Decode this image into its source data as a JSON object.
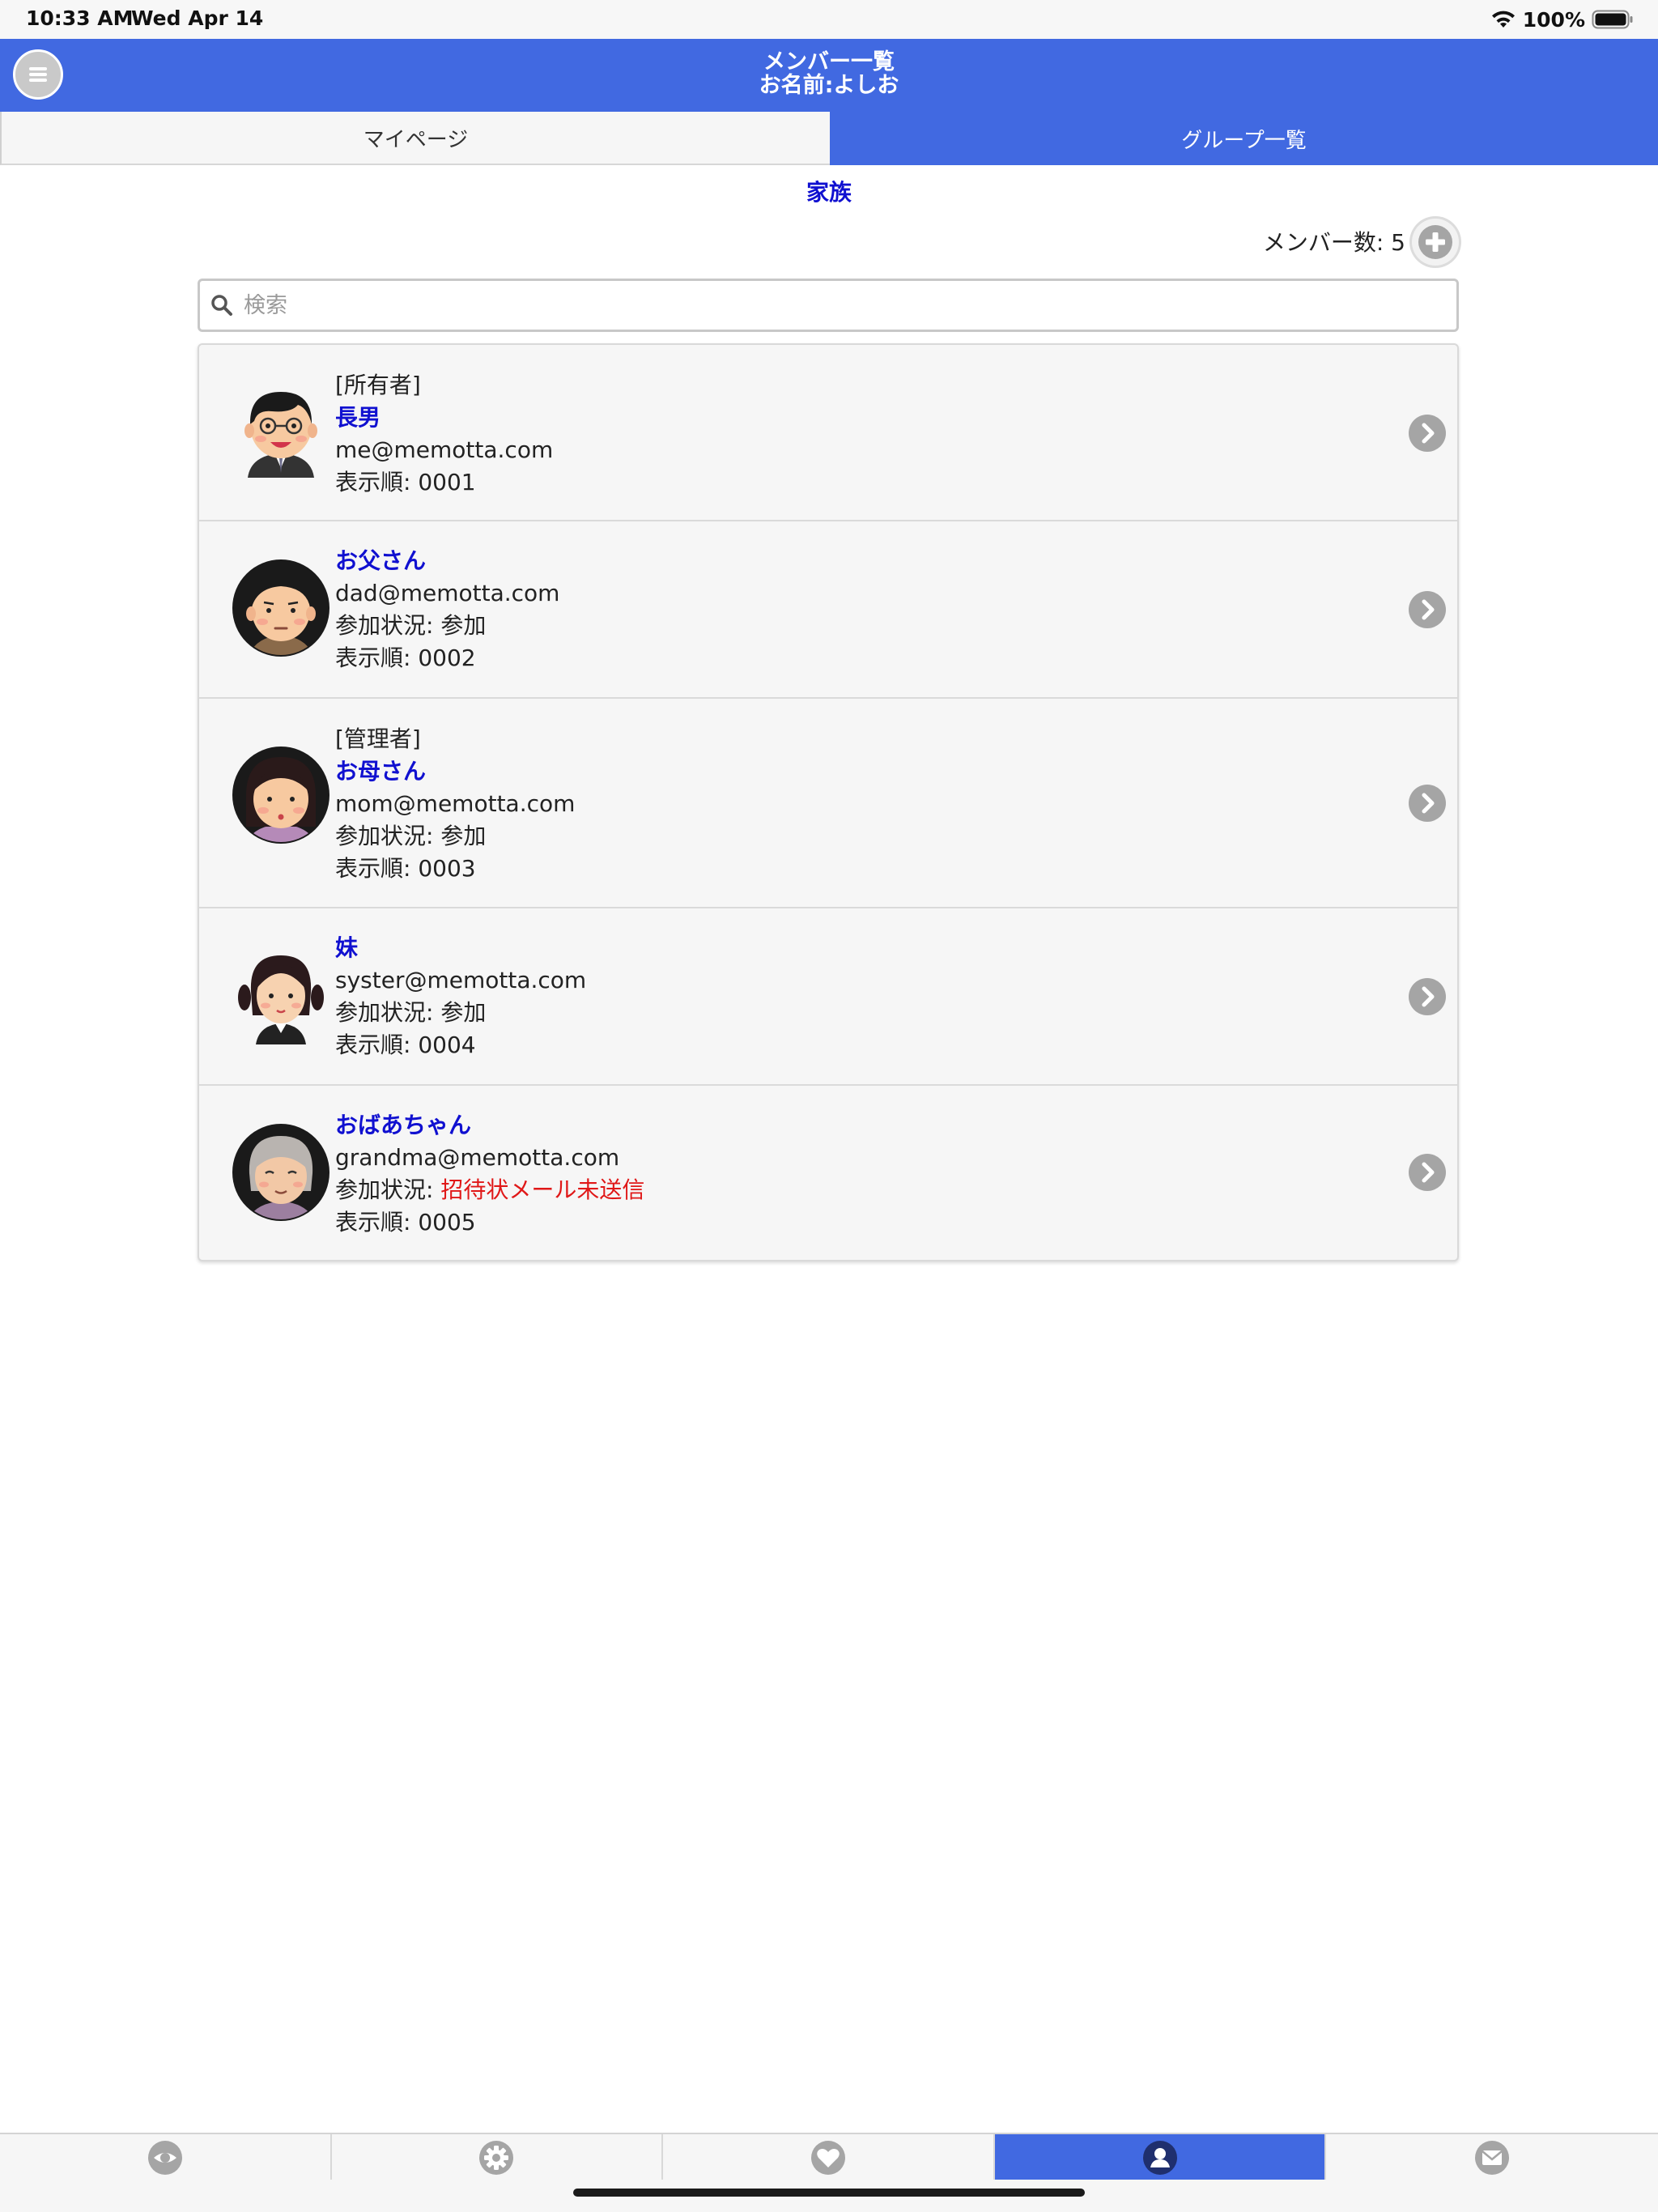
{
  "status_bar": {
    "time": "10:33 AM",
    "date": "Wed Apr 14",
    "battery": "100%"
  },
  "header": {
    "title": "メンバー一覧",
    "subtitle": "お名前:よしお"
  },
  "tabs": [
    {
      "label": "マイページ"
    },
    {
      "label": "グループ一覧"
    }
  ],
  "group": {
    "name": "家族"
  },
  "member_count": {
    "label": "メンバー数: 5"
  },
  "search": {
    "placeholder": "検索"
  },
  "members": [
    {
      "role": "[所有者]",
      "name": "長男",
      "email": "me@memotta.com",
      "order": "表示順: 0001"
    },
    {
      "name": "お父さん",
      "email": "dad@memotta.com",
      "status_label": "参加状況: ",
      "status": "参加",
      "order": "表示順: 0002"
    },
    {
      "role": "[管理者]",
      "name": "お母さん",
      "email": "mom@memotta.com",
      "status_label": "参加状況: ",
      "status": "参加",
      "order": "表示順: 0003"
    },
    {
      "name": "妹",
      "email": "syster@memotta.com",
      "status_label": "参加状況: ",
      "status": "参加",
      "order": "表示順: 0004"
    },
    {
      "name": "おばあちゃん",
      "email": "grandma@memotta.com",
      "status_label": "参加状況: ",
      "status": "招待状メール未送信",
      "order": "表示順: 0005"
    }
  ],
  "bottom_tabs": [
    {
      "icon": "eye-icon"
    },
    {
      "icon": "gear-icon"
    },
    {
      "icon": "heart-icon"
    },
    {
      "icon": "person-icon",
      "active": true
    },
    {
      "icon": "mail-icon"
    }
  ],
  "colors": {
    "brand_blue": "#4169e1",
    "name_blue": "#1010d0",
    "warn_red": "#e01818"
  }
}
